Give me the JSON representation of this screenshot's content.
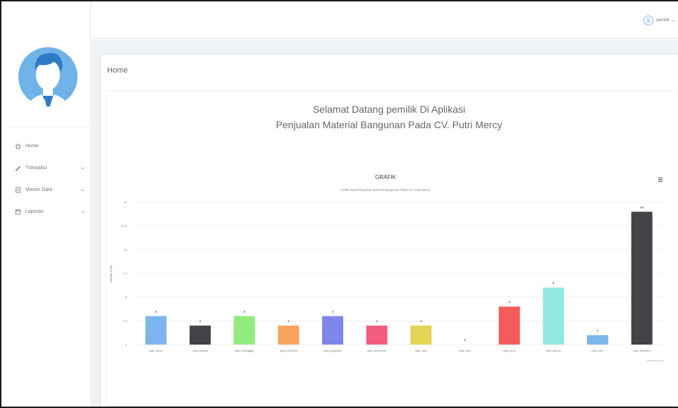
{
  "user": {
    "name": "pemilik"
  },
  "sidebar": {
    "items": [
      {
        "label": "Home",
        "icon": "home-icon",
        "expandable": false
      },
      {
        "label": "Transaksi",
        "icon": "pencil-icon",
        "expandable": true
      },
      {
        "label": "Master Data",
        "icon": "document-icon",
        "expandable": true
      },
      {
        "label": "Laporan",
        "icon": "calendar-icon",
        "expandable": true
      }
    ]
  },
  "main": {
    "page_title": "Home",
    "welcome_line1": "Selamat Datang pemilik Di Aplikasi",
    "welcome_line2": "Penjualan Material Bangunan Pada CV. Putri Mercy"
  },
  "colors": {
    "accent": "#20a8d8",
    "sidebar_bg": "#ffffff",
    "content_bg": "#f0f3f5"
  },
  "chart_data": {
    "type": "bar",
    "title": "GRAFIK",
    "subtitle": "Grafik Data Penjualan Material Bangunan Pada CV. Putri Mercy",
    "xlabel": "",
    "ylabel": "Jumlah Data",
    "credits": "Highcharts.com",
    "ylim": [
      0,
      12
    ],
    "yticks": [
      "0",
      "2.5",
      "5",
      "7.5",
      "10",
      "12.5",
      "15"
    ],
    "categories": [
      "data_admin",
      "data_barang",
      "data_pelanggan",
      "data_pemasok",
      "data_penjualan",
      "data_pembelian",
      "data_stok",
      "data_retur",
      "data_jenis",
      "data_satuan",
      "data_user",
      "data_transaksi"
    ],
    "values": [
      3,
      2,
      3,
      2,
      3,
      2,
      2,
      0,
      4,
      6,
      1,
      14
    ],
    "colors": [
      "#7cb5ec",
      "#434348",
      "#90ed7d",
      "#f7a35c",
      "#8085e9",
      "#f15c80",
      "#e4d354",
      "#2b908f",
      "#f45b5b",
      "#91e8e1",
      "#7cb5ec",
      "#434348"
    ],
    "grid": true,
    "legend": "none"
  }
}
